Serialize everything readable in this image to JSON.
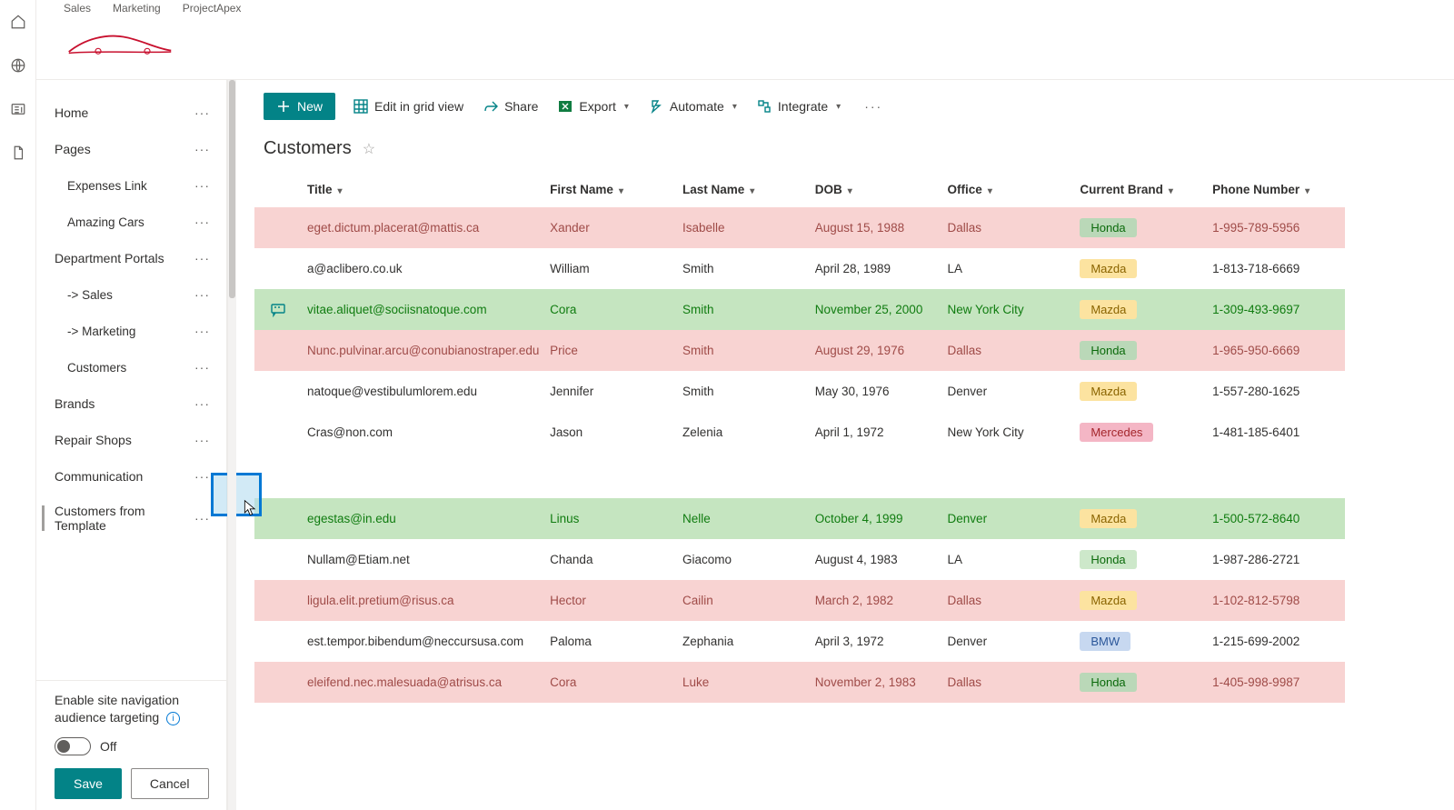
{
  "header": {
    "links": [
      "Sales",
      "Marketing",
      "ProjectApex"
    ]
  },
  "sideNav": {
    "items": [
      {
        "label": "Home",
        "level": 0
      },
      {
        "label": "Pages",
        "level": 0
      },
      {
        "label": "Expenses Link",
        "level": 1
      },
      {
        "label": "Amazing Cars",
        "level": 1
      },
      {
        "label": "Department Portals",
        "level": 0
      },
      {
        "label": "-> Sales",
        "level": 1
      },
      {
        "label": "-> Marketing",
        "level": 1
      },
      {
        "label": "Customers",
        "level": 1
      },
      {
        "label": "Brands",
        "level": 0
      },
      {
        "label": "Repair Shops",
        "level": 0
      },
      {
        "label": "Communication",
        "level": 0
      },
      {
        "label": "Customers from Template",
        "level": 0,
        "selected": true
      }
    ],
    "footer": {
      "title": "Enable site navigation audience targeting",
      "toggleState": "Off",
      "save": "Save",
      "cancel": "Cancel"
    }
  },
  "toolbar": {
    "new": "New",
    "editGrid": "Edit in grid view",
    "share": "Share",
    "export": "Export",
    "automate": "Automate",
    "integrate": "Integrate"
  },
  "list": {
    "title": "Customers",
    "columns": [
      "Title",
      "First Name",
      "Last Name",
      "DOB",
      "Office",
      "Current Brand",
      "Phone Number"
    ],
    "rows": [
      {
        "style": "red",
        "title": "eget.dictum.placerat@mattis.ca",
        "first": "Xander",
        "last": "Isabelle",
        "dob": "August 15, 1988",
        "office": "Dallas",
        "brand": "Honda",
        "phone": "1-995-789-5956"
      },
      {
        "style": "",
        "title": "a@aclibero.co.uk",
        "first": "William",
        "last": "Smith",
        "dob": "April 28, 1989",
        "office": "LA",
        "brand": "Mazda",
        "phone": "1-813-718-6669"
      },
      {
        "style": "green",
        "title": "vitae.aliquet@sociisnatoque.com",
        "first": "Cora",
        "last": "Smith",
        "dob": "November 25, 2000",
        "office": "New York City",
        "brand": "Mazda",
        "phone": "1-309-493-9697",
        "comment": true
      },
      {
        "style": "red",
        "title": "Nunc.pulvinar.arcu@conubianostraper.edu",
        "first": "Price",
        "last": "Smith",
        "dob": "August 29, 1976",
        "office": "Dallas",
        "brand": "Honda",
        "phone": "1-965-950-6669"
      },
      {
        "style": "",
        "title": "natoque@vestibulumlorem.edu",
        "first": "Jennifer",
        "last": "Smith",
        "dob": "May 30, 1976",
        "office": "Denver",
        "brand": "Mazda",
        "phone": "1-557-280-1625"
      },
      {
        "style": "",
        "title": "Cras@non.com",
        "first": "Jason",
        "last": "Zelenia",
        "dob": "April 1, 1972",
        "office": "New York City",
        "brand": "Mercedes",
        "phone": "1-481-185-6401"
      },
      {
        "style": "spacer"
      },
      {
        "style": "green",
        "title": "egestas@in.edu",
        "first": "Linus",
        "last": "Nelle",
        "dob": "October 4, 1999",
        "office": "Denver",
        "brand": "Mazda",
        "phone": "1-500-572-8640"
      },
      {
        "style": "",
        "title": "Nullam@Etiam.net",
        "first": "Chanda",
        "last": "Giacomo",
        "dob": "August 4, 1983",
        "office": "LA",
        "brand": "Honda",
        "phone": "1-987-286-2721"
      },
      {
        "style": "red",
        "title": "ligula.elit.pretium@risus.ca",
        "first": "Hector",
        "last": "Cailin",
        "dob": "March 2, 1982",
        "office": "Dallas",
        "brand": "Mazda",
        "phone": "1-102-812-5798"
      },
      {
        "style": "",
        "title": "est.tempor.bibendum@neccursusa.com",
        "first": "Paloma",
        "last": "Zephania",
        "dob": "April 3, 1972",
        "office": "Denver",
        "brand": "BMW",
        "phone": "1-215-699-2002"
      },
      {
        "style": "red",
        "title": "eleifend.nec.malesuada@atrisus.ca",
        "first": "Cora",
        "last": "Luke",
        "dob": "November 2, 1983",
        "office": "Dallas",
        "brand": "Honda",
        "phone": "1-405-998-9987"
      }
    ]
  }
}
